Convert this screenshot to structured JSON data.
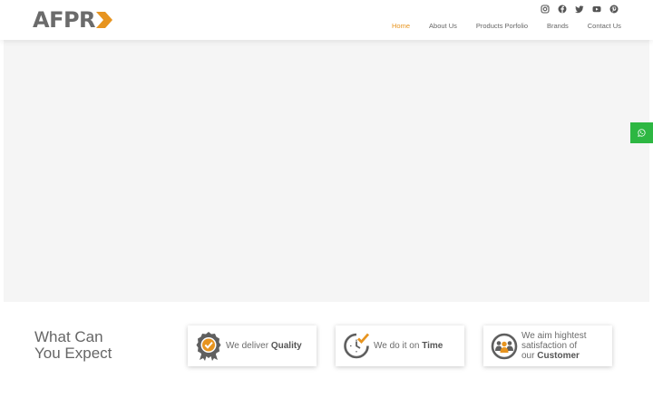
{
  "header": {
    "logo": {
      "text": "AFPR"
    },
    "social_icons": [
      "instagram-icon",
      "facebook-icon",
      "twitter-icon",
      "youtube-icon",
      "pinterest-icon"
    ],
    "nav": [
      {
        "label": "Home",
        "active": true
      },
      {
        "label": "About Us",
        "active": false
      },
      {
        "label": "Products Porfolio",
        "active": false
      },
      {
        "label": "Brands",
        "active": false
      },
      {
        "label": "Contact Us",
        "active": false
      }
    ]
  },
  "whatsapp": {
    "icon": "whatsapp-icon",
    "color": "#2db742"
  },
  "expect": {
    "title_line1": "What Can",
    "title_line2": "You Expect",
    "cards": [
      {
        "icon": "quality-badge-icon",
        "prefix": "We deliver ",
        "bold": "Quality"
      },
      {
        "icon": "clock-check-icon",
        "prefix": "We do it on ",
        "bold": "Time"
      },
      {
        "icon": "customers-icon",
        "line1": "We aim hightest",
        "line2": "satisfaction of",
        "prefix": "our ",
        "bold": "Customer"
      }
    ]
  },
  "colors": {
    "accent": "#e7941f",
    "text": "#666666",
    "hero_bg": "#f5f5f5"
  }
}
